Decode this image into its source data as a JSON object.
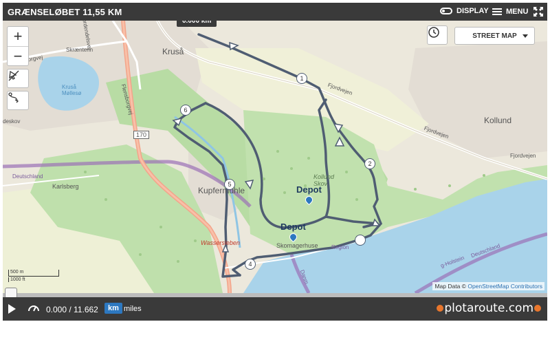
{
  "header": {
    "title": "GRÆNSELØBET 11,55 KM",
    "display_label": "DISPLAY",
    "menu_label": "MENU"
  },
  "map": {
    "map_type": "STREET MAP",
    "distance_label": "0.000 km",
    "scale_m": "500 m",
    "scale_ft": "1000 ft",
    "attribution_prefix": "Map Data ©",
    "attribution_link": "OpenStreetMap Contributors",
    "places": {
      "krusa": "Kruså",
      "kollund": "Kollund",
      "kupfermuhle": "Kupfermühle",
      "karlsberg": "Karlsberg",
      "padborgvej": "Padborgvej",
      "skrantenen": "Skræntenn",
      "flensborgvej": "Flensborgvej",
      "fjordvejen1": "Fjordvejen",
      "fjordvejen2": "Fjordvejen",
      "fjordvejen3": "Fjordvejen",
      "krusa_mollesø": "Kruså Møllesø",
      "kollund_skov": "Kollund Skov",
      "deutschland1": "Deutschland",
      "deutschland2": "Deutschland",
      "wassersleben": "Wassersleben",
      "skomagerhuse": "Skomagerhuse",
      "fjordendelsvej": "Fjordendelsvej",
      "deskov": "deskov",
      "road170": "170",
      "holstein": "g-Holstein",
      "dan": "Danm",
      "region": "Region"
    },
    "depots": [
      "Depot",
      "Depot"
    ],
    "markers": [
      "1",
      "2",
      "4",
      "5",
      "6"
    ]
  },
  "player": {
    "distance": "0.000 / 11.662",
    "unit_km": "km",
    "unit_miles": "miles",
    "brand": "plotaroute.com"
  },
  "colors": {
    "route": "#4f5d72",
    "water": "#a9d3ea",
    "forest": "#b8dca4",
    "bar": "#3a3a3a",
    "accent": "#2d78c0",
    "border": "#9b70b7"
  }
}
